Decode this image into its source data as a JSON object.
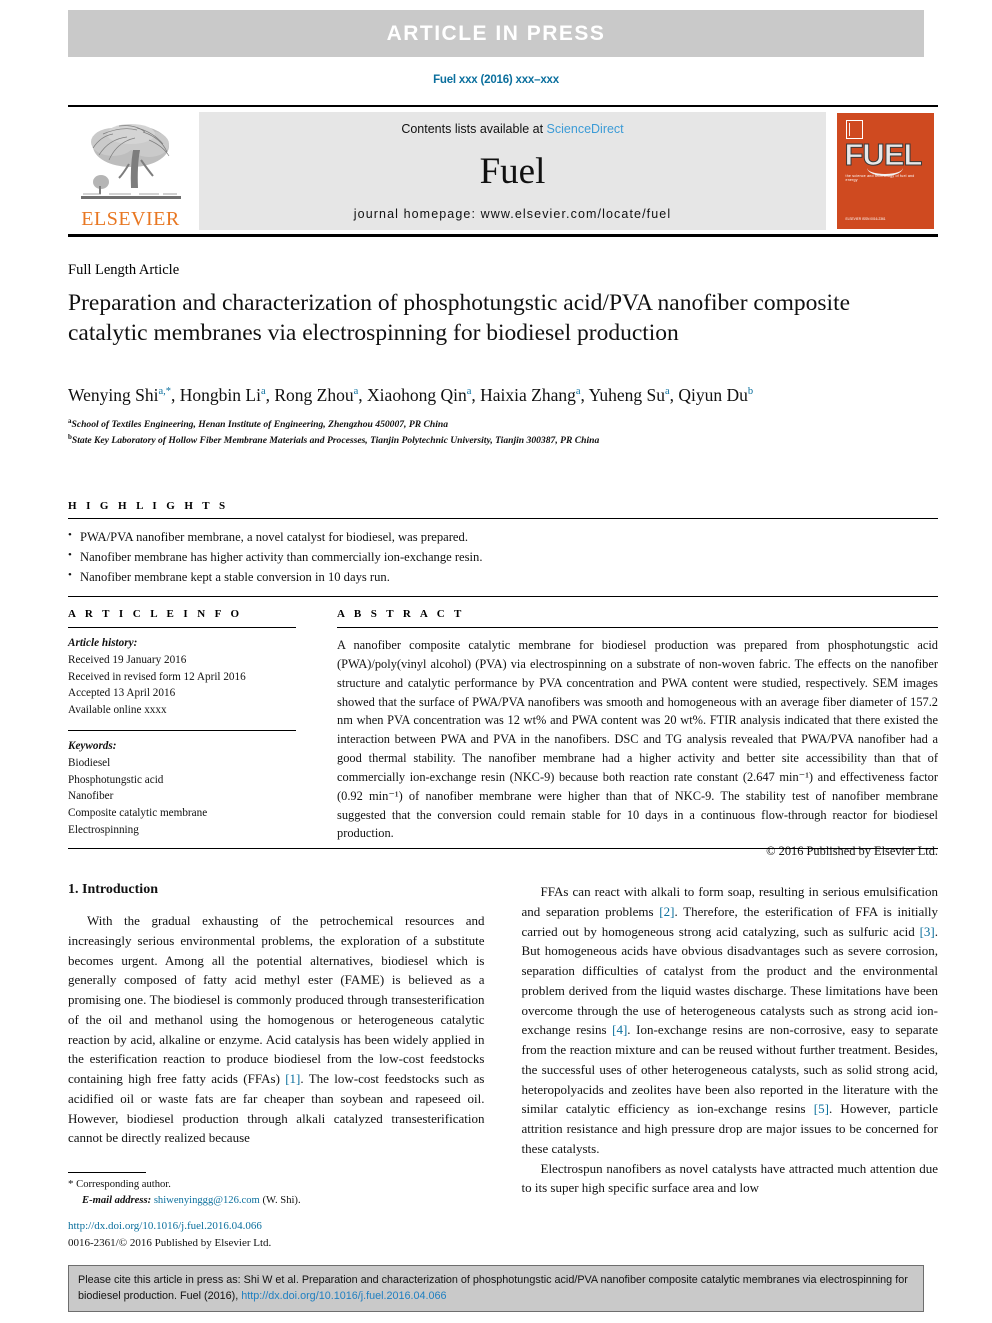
{
  "banner": {
    "label": "ARTICLE IN PRESS"
  },
  "running_head": "Fuel xxx (2016) xxx–xxx",
  "masthead": {
    "publisher": "ELSEVIER",
    "contents_prefix": "Contents lists available at ",
    "contents_link": "ScienceDirect",
    "journal_name": "Fuel",
    "homepage": "journal homepage: www.elsevier.com/locate/fuel",
    "cover": {
      "wordmark": "FUEL",
      "subtitle": "the science and technology of fuel and energy",
      "footer": "ELSEVIER ISSN 0016-2361"
    }
  },
  "article_type": "Full Length Article",
  "title": "Preparation and characterization of phosphotungstic acid/PVA nanofiber composite catalytic membranes via electrospinning for biodiesel production",
  "authors": [
    {
      "name": "Wenying Shi",
      "sup": "a,*"
    },
    {
      "name": "Hongbin Li",
      "sup": "a"
    },
    {
      "name": "Rong Zhou",
      "sup": "a"
    },
    {
      "name": "Xiaohong Qin",
      "sup": "a"
    },
    {
      "name": "Haixia Zhang",
      "sup": "a"
    },
    {
      "name": "Yuheng Su",
      "sup": "a"
    },
    {
      "name": "Qiyun Du",
      "sup": "b"
    }
  ],
  "affiliations": [
    {
      "marker": "a",
      "text": "School of Textiles Engineering, Henan Institute of Engineering, Zhengzhou 450007, PR China"
    },
    {
      "marker": "b",
      "text": "State Key Laboratory of Hollow Fiber Membrane Materials and Processes, Tianjin Polytechnic University, Tianjin 300387, PR China"
    }
  ],
  "highlights": {
    "heading": "H I G H L I G H T S",
    "items": [
      "PWA/PVA nanofiber membrane, a novel catalyst for biodiesel, was prepared.",
      "Nanofiber membrane has higher activity than commercially ion-exchange resin.",
      "Nanofiber membrane kept a stable conversion in 10 days run."
    ]
  },
  "article_info": {
    "heading": "A R T I C L E   I N F O",
    "history_label": "Article history:",
    "history": [
      "Received 19 January 2016",
      "Received in revised form 12 April 2016",
      "Accepted 13 April 2016",
      "Available online xxxx"
    ],
    "keywords_label": "Keywords:",
    "keywords": [
      "Biodiesel",
      "Phosphotungstic acid",
      "Nanofiber",
      "Composite catalytic membrane",
      "Electrospinning"
    ]
  },
  "abstract": {
    "heading": "A B S T R A C T",
    "body": "A nanofiber composite catalytic membrane for biodiesel production was prepared from phosphotungstic acid (PWA)/poly(vinyl alcohol) (PVA) via electrospinning on a substrate of non-woven fabric. The effects on the nanofiber structure and catalytic performance by PVA concentration and PWA content were studied, respectively. SEM images showed that the surface of PWA/PVA nanofibers was smooth and homogeneous with an average fiber diameter of 157.2 nm when PVA concentration was 12 wt% and PWA content was 20 wt%. FTIR analysis indicated that there existed the interaction between PWA and PVA in the nanofibers. DSC and TG analysis revealed that PWA/PVA nanofiber had a good thermal stability. The nanofiber membrane had a higher activity and better site accessibility than that of commercially ion-exchange resin (NKC-9) because both reaction rate constant (2.647 min⁻¹) and effectiveness factor (0.92 min⁻¹) of nanofiber membrane were higher than that of NKC-9. The stability test of nanofiber membrane suggested that the conversion could remain stable for 10 days in a continuous flow-through reactor for biodiesel production.",
    "copyright": "© 2016 Published by Elsevier Ltd."
  },
  "body": {
    "section_heading": "1. Introduction",
    "left_paragraph": "With the gradual exhausting of the petrochemical resources and increasingly serious environmental problems, the exploration of a substitute becomes urgent. Among all the potential alternatives, biodiesel which is generally composed of fatty acid methyl ester (FAME) is believed as a promising one. The biodiesel is commonly produced through transesterification of the oil and methanol using the homogenous or heterogeneous catalytic reaction by acid, alkaline or enzyme. Acid catalysis has been widely applied in the esterification reaction to produce biodiesel from the low-cost feedstocks containing high free fatty acids (FFAs) [1]. The low-cost feedstocks such as acidified oil or waste fats are far cheaper than soybean and rapeseed oil. However, biodiesel production through alkali catalyzed transesterification cannot be directly realized because",
    "right_paragraph_1": "FFAs can react with alkali to form soap, resulting in serious emulsification and separation problems [2]. Therefore, the esterification of FFA is initially carried out by homogeneous strong acid catalyzing, such as sulfuric acid [3]. But homogeneous acids have obvious disadvantages such as severe corrosion, separation difficulties of catalyst from the product and the environmental problem derived from the liquid wastes discharge. These limitations have been overcome through the use of heterogeneous catalysts such as strong acid ion-exchange resins [4]. Ion-exchange resins are non-corrosive, easy to separate from the reaction mixture and can be reused without further treatment. Besides, the successful uses of other heterogeneous catalysts, such as solid strong acid, heteropolyacids and zeolites have been also reported in the literature with the similar catalytic efficiency as ion-exchange resins [5]. However, particle attrition resistance and high pressure drop are major issues to be concerned for these catalysts.",
    "right_paragraph_2": "Electrospun nanofibers as novel catalysts have attracted much attention due to its super high specific surface area and low"
  },
  "footnote": {
    "corresponding_marker": "*",
    "corresponding_label": "Corresponding author.",
    "email_label": "E-mail address:",
    "email": "shiwenyinggg@126.com",
    "email_owner": "(W. Shi)."
  },
  "doi": {
    "url": "http://dx.doi.org/10.1016/j.fuel.2016.04.066",
    "issn_line": "0016-2361/© 2016 Published by Elsevier Ltd."
  },
  "cite_box": {
    "text_prefix": "Please cite this article in press as: Shi W et al. Preparation and characterization of phosphotungstic acid/PVA nanofiber composite catalytic membranes via electrospinning for biodiesel production. Fuel (2016), ",
    "link": "http://dx.doi.org/10.1016/j.fuel.2016.04.066"
  },
  "colors": {
    "link": "#0b6f9d",
    "sciencedirect": "#3c9bd6",
    "elsevier_orange": "#e87722",
    "banner_gray": "#c9c9c9",
    "masthead_gray": "#e6e6e6",
    "cover_orange": "#cf4a20"
  }
}
